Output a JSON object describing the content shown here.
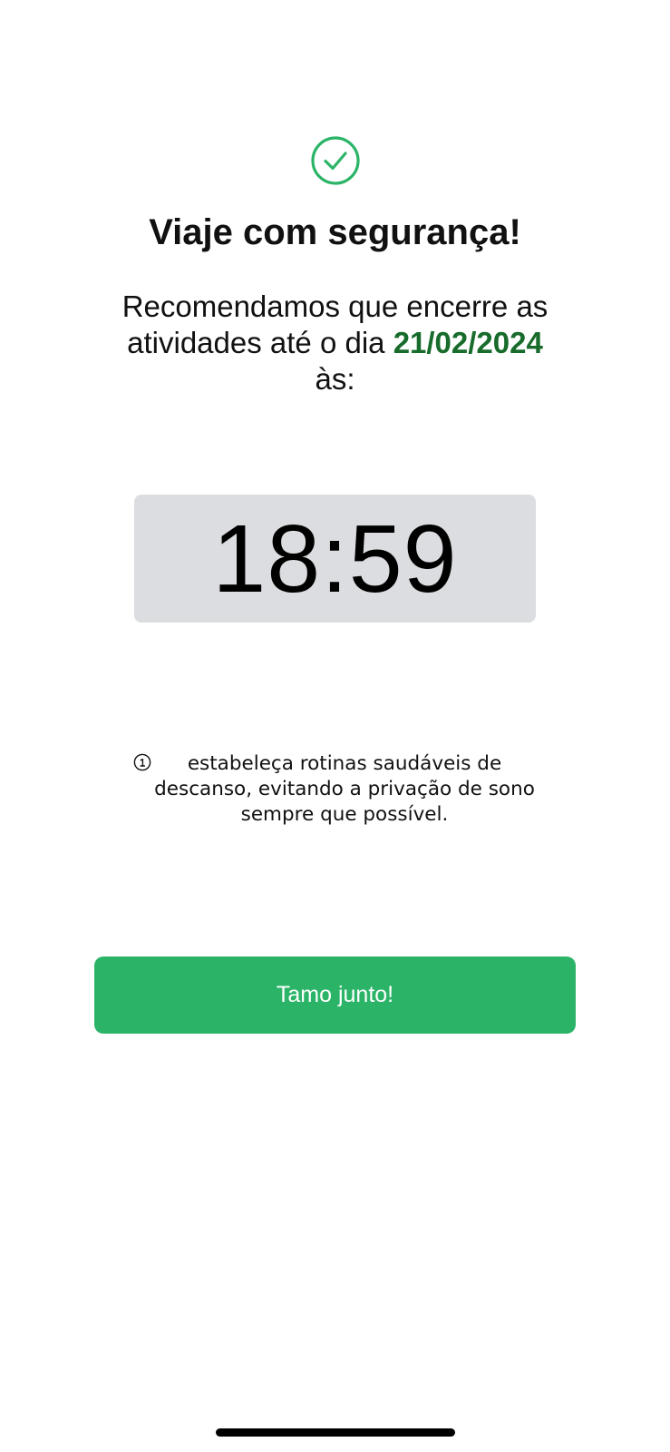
{
  "header": {
    "icon": "check-circle-icon",
    "title": "Viaje com segurança!"
  },
  "message": {
    "line_prefix": "Recomendamos que encerre as atividades até o dia ",
    "date": "21/02/2024",
    "line_suffix": " às:"
  },
  "deadline": {
    "time": "18:59"
  },
  "tip": {
    "icon": "info-icon",
    "text": "estabeleça rotinas saudáveis de descanso, evitando a privação de sono sempre que possível."
  },
  "action": {
    "button_label": "Tamo junto!"
  },
  "colors": {
    "accent_green": "#2bb467",
    "date_green": "#176b2b",
    "time_box_bg": "#dcdde1"
  }
}
